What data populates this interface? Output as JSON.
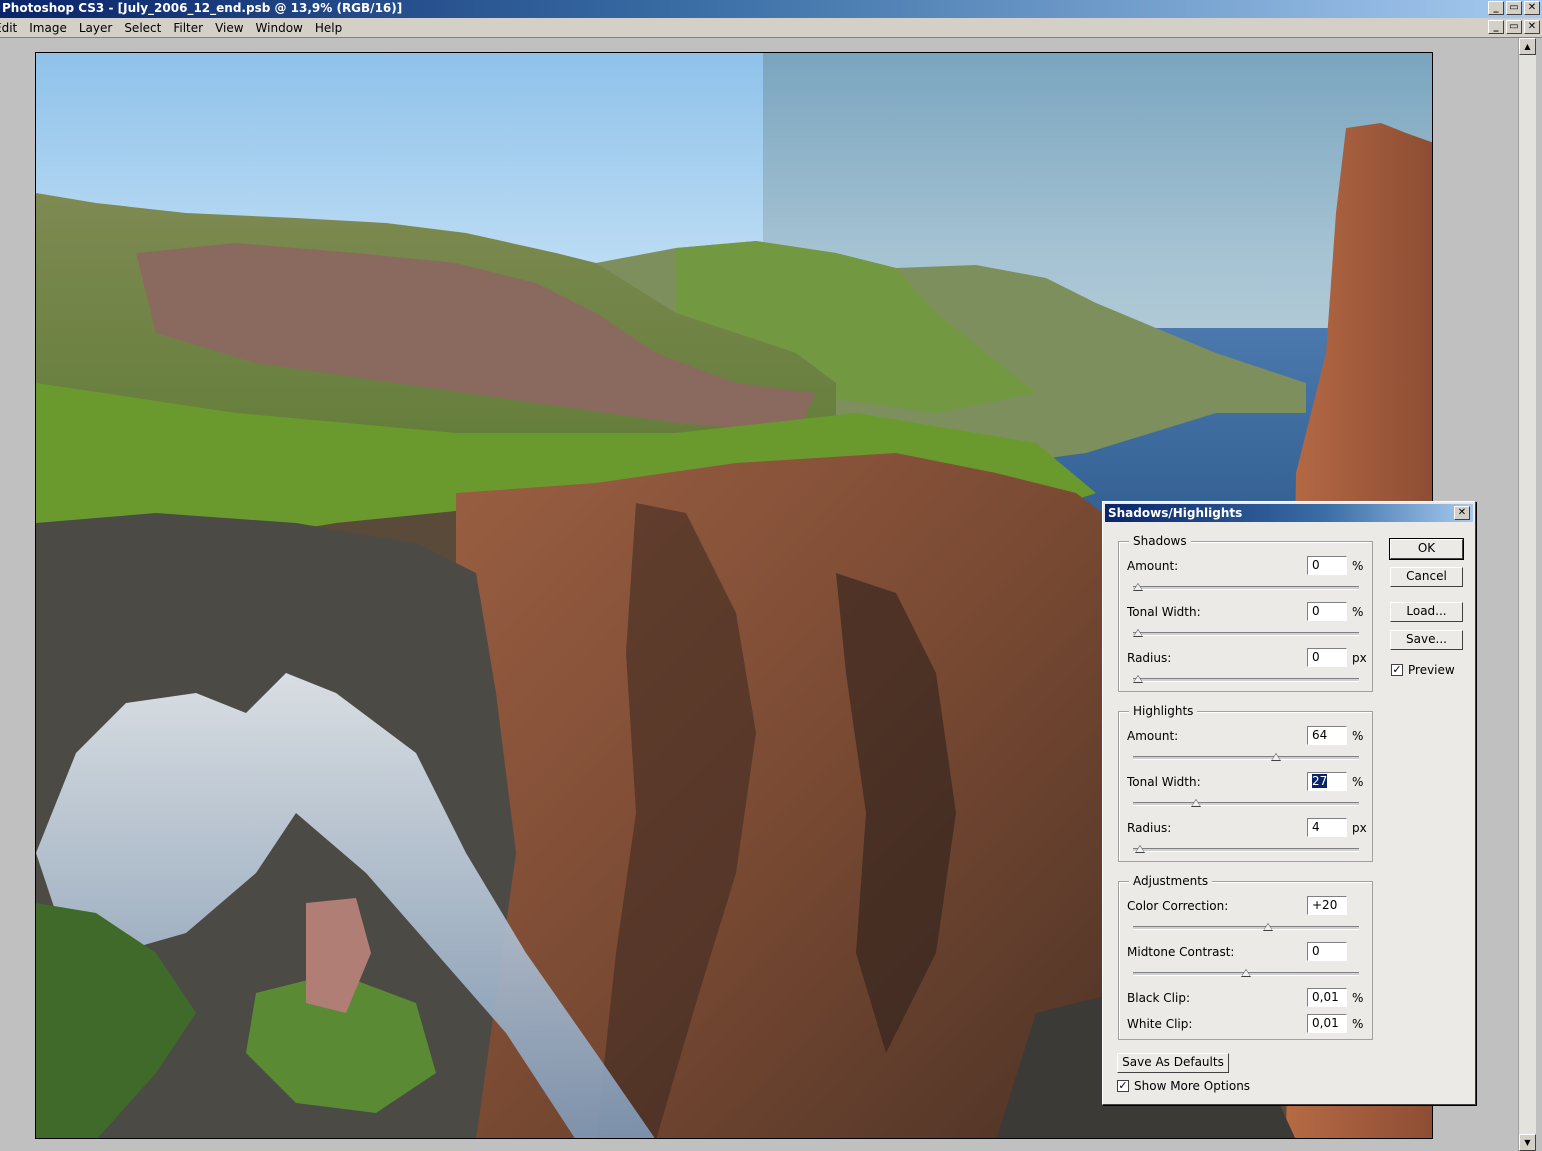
{
  "window": {
    "title": "Photoshop CS3 - [July_2006_12_end.psb @ 13,9% (RGB/16)]",
    "controls": [
      "_",
      "▭",
      "✕"
    ]
  },
  "menu": [
    "Edit",
    "Image",
    "Layer",
    "Select",
    "Filter",
    "View",
    "Window",
    "Help"
  ],
  "dialog": {
    "title": "Shadows/Highlights",
    "shadows": {
      "title": "Shadows",
      "amount": {
        "label": "Amount:",
        "value": "0",
        "unit": "%",
        "level": 0
      },
      "tonal_width": {
        "label": "Tonal Width:",
        "value": "0",
        "unit": "%",
        "level": 0
      },
      "radius": {
        "label": "Radius:",
        "value": "0",
        "unit": "px",
        "level": 0
      }
    },
    "highlights": {
      "title": "Highlights",
      "amount": {
        "label": "Amount:",
        "value": "64",
        "unit": "%",
        "level": 0.64
      },
      "tonal_width": {
        "label": "Tonal Width:",
        "value": "27",
        "unit": "%",
        "level": 0.27
      },
      "radius": {
        "label": "Radius:",
        "value": "4",
        "unit": "px",
        "level": 0.01
      }
    },
    "adjustments": {
      "title": "Adjustments",
      "color_correction": {
        "label": "Color Correction:",
        "value": "+20",
        "level": 0.6
      },
      "midtone_contrast": {
        "label": "Midtone Contrast:",
        "value": "0",
        "level": 0.5
      },
      "black_clip": {
        "label": "Black Clip:",
        "value": "0,01",
        "unit": "%"
      },
      "white_clip": {
        "label": "White Clip:",
        "value": "0,01",
        "unit": "%"
      }
    },
    "buttons": {
      "ok": "OK",
      "cancel": "Cancel",
      "load": "Load...",
      "save": "Save...",
      "save_defaults": "Save As Defaults"
    },
    "preview": {
      "label": "Preview",
      "checked": true
    },
    "show_more": {
      "label": "Show More Options",
      "checked": true
    }
  }
}
